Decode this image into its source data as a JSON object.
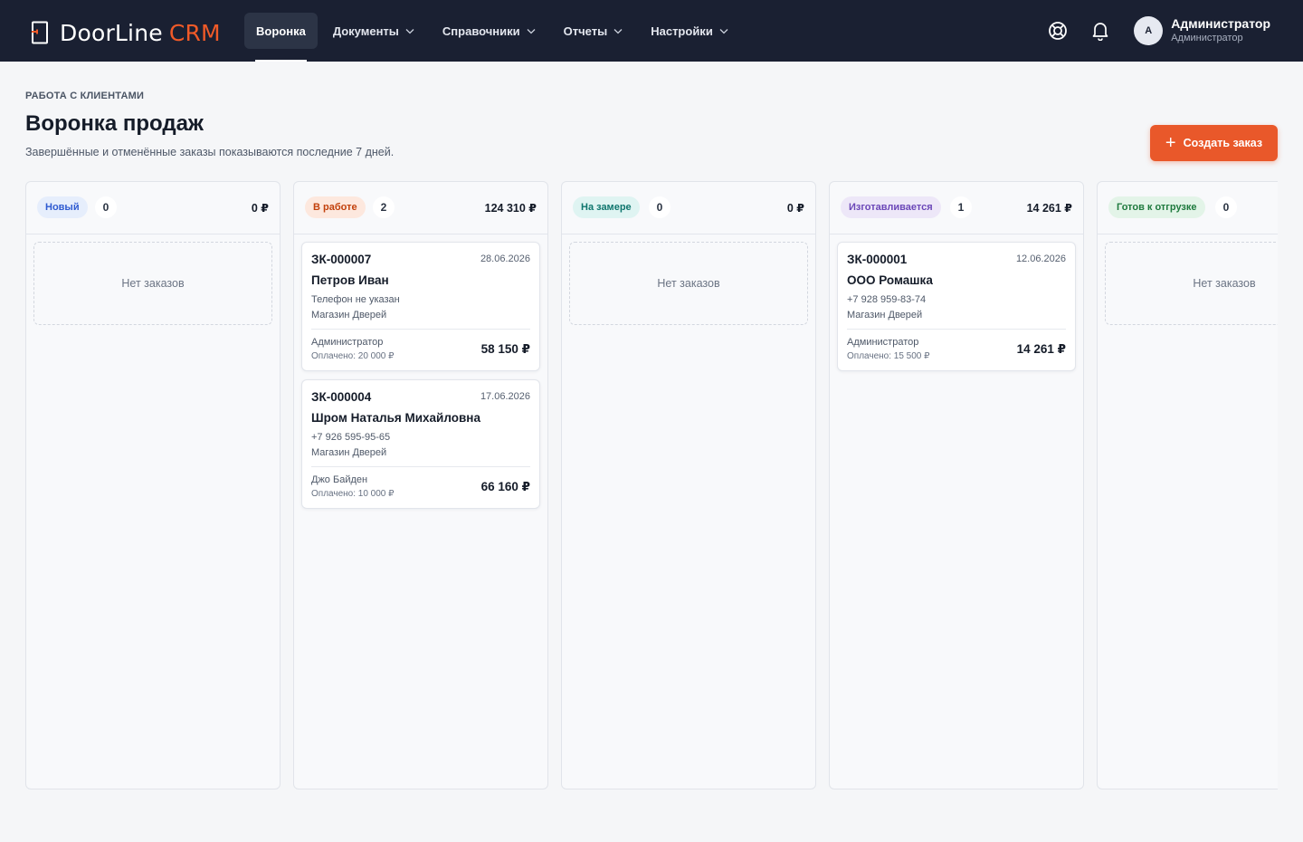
{
  "brand": {
    "name": "DoorLine",
    "accent": "CRM",
    "accent_color": "#f05a28"
  },
  "nav": {
    "items": [
      {
        "label": "Воронка",
        "active": true,
        "has_dropdown": false
      },
      {
        "label": "Документы",
        "active": false,
        "has_dropdown": true
      },
      {
        "label": "Справочники",
        "active": false,
        "has_dropdown": true
      },
      {
        "label": "Отчеты",
        "active": false,
        "has_dropdown": true
      },
      {
        "label": "Настройки",
        "active": false,
        "has_dropdown": true
      }
    ]
  },
  "header_icons": [
    "help-icon",
    "bell-icon"
  ],
  "user": {
    "initial": "A",
    "name": "Администратор",
    "role": "Администратор"
  },
  "page": {
    "breadcrumb": "РАБОТА С КЛИЕНТАМИ",
    "title": "Воронка продаж",
    "subtitle": "Завершённые и отменённые заказы показываются последние 7 дней.",
    "create_button": "Создать заказ"
  },
  "columns": [
    {
      "name": "Новый",
      "count": "0",
      "sum": "0 ₽",
      "pill_bg": "#e6eefc",
      "pill_color": "#2f5bd1",
      "empty_text": "Нет заказов",
      "orders": []
    },
    {
      "name": "В работе",
      "count": "2",
      "sum": "124 310 ₽",
      "pill_bg": "#fde8de",
      "pill_color": "#c2410c",
      "empty_text": "",
      "orders": [
        {
          "number": "ЗК-000007",
          "date": "28.06.2026",
          "client": "Петров Иван",
          "phone": "Телефон не указан",
          "store": "Магазин Дверей",
          "manager": "Администратор",
          "paid": "Оплачено: 20 000 ₽",
          "total": "58 150 ₽"
        },
        {
          "number": "ЗК-000004",
          "date": "17.06.2026",
          "client": "Шром Наталья Михайловна",
          "phone": "+7 926 595-95-65",
          "store": "Магазин Дверей",
          "manager": "Джо Байден",
          "paid": "Оплачено: 10 000 ₽",
          "total": "66 160 ₽"
        }
      ]
    },
    {
      "name": "На замере",
      "count": "0",
      "sum": "0 ₽",
      "pill_bg": "#dff4f2",
      "pill_color": "#0f766e",
      "empty_text": "Нет заказов",
      "orders": []
    },
    {
      "name": "Изготавливается",
      "count": "1",
      "sum": "14 261 ₽",
      "pill_bg": "#ede7f8",
      "pill_color": "#6b47b8",
      "empty_text": "",
      "orders": [
        {
          "number": "ЗК-000001",
          "date": "12.06.2026",
          "client": "ООО Ромашка",
          "phone": "+7 928 959-83-74",
          "store": "Магазин Дверей",
          "manager": "Администратор",
          "paid": "Оплачено: 15 500 ₽",
          "total": "14 261 ₽"
        }
      ]
    },
    {
      "name": "Готов к отгрузке",
      "count": "0",
      "sum": "",
      "pill_bg": "#e3f4e8",
      "pill_color": "#1f7a3e",
      "empty_text": "Нет заказов",
      "orders": []
    }
  ]
}
